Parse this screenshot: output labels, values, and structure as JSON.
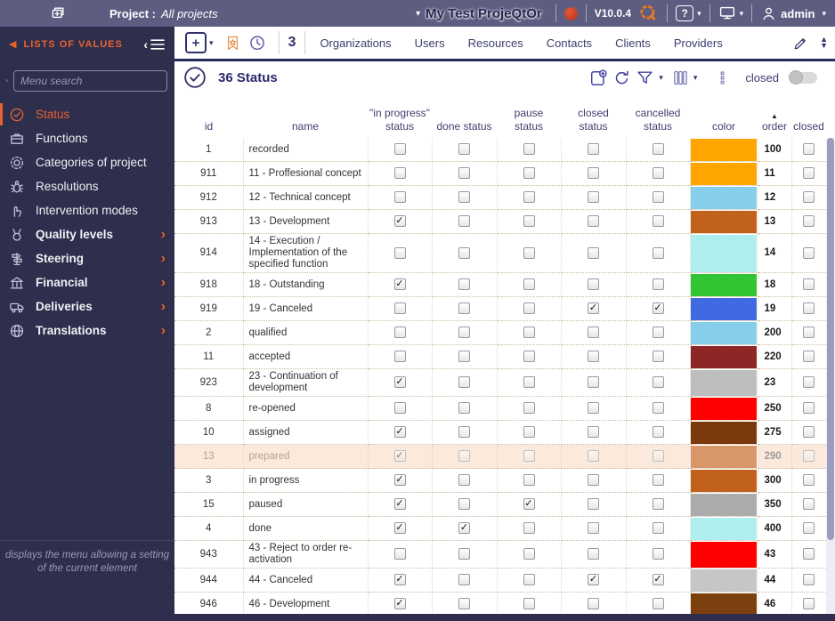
{
  "icons": {
    "caret_down": "▾",
    "chevron_right": "›",
    "sort_asc": "▲",
    "check": "✓",
    "collapse_left": "‹",
    "arrow_left": "◀",
    "up_arrow": "▲",
    "down_arrow": "▼",
    "plus": "+"
  },
  "topbar": {
    "project_label": "Project :",
    "project_value": "All projects",
    "app_title": "My Test ProjeQtOr",
    "version": "V10.0.4",
    "help_label": "?",
    "user_name": "admin"
  },
  "tabbar": {
    "count_badge": "3",
    "tabs": [
      "Organizations",
      "Users",
      "Resources",
      "Contacts",
      "Clients",
      "Providers"
    ]
  },
  "sidebar": {
    "header": "LISTS OF VALUES",
    "search_placeholder": "Menu search",
    "items": [
      {
        "label": "Status",
        "icon": "check-circle-icon",
        "active": true,
        "expandable": false
      },
      {
        "label": "Functions",
        "icon": "briefcase-icon",
        "active": false,
        "expandable": false
      },
      {
        "label": "Categories of project",
        "icon": "gear-icon",
        "active": false,
        "expandable": false
      },
      {
        "label": "Resolutions",
        "icon": "bug-icon",
        "active": false,
        "expandable": false
      },
      {
        "label": "Intervention modes",
        "icon": "hand-icon",
        "active": false,
        "expandable": false
      },
      {
        "label": "Quality levels",
        "icon": "medal-icon",
        "active": false,
        "expandable": true
      },
      {
        "label": "Steering",
        "icon": "signpost-icon",
        "active": false,
        "expandable": true
      },
      {
        "label": "Financial",
        "icon": "bank-icon",
        "active": false,
        "expandable": true
      },
      {
        "label": "Deliveries",
        "icon": "truck-icon",
        "active": false,
        "expandable": true
      },
      {
        "label": "Translations",
        "icon": "globe-icon",
        "active": false,
        "expandable": true
      }
    ],
    "footer_note": "displays the menu allowing a setting of the current element"
  },
  "content": {
    "title": "36 Status",
    "toolbar": {
      "closed_toggle_label": "closed"
    },
    "table": {
      "columns": [
        {
          "key": "id",
          "label": "id",
          "type": "text"
        },
        {
          "key": "name",
          "label": "name",
          "type": "text"
        },
        {
          "key": "in_progress",
          "label": "\"in progress\" status",
          "type": "check"
        },
        {
          "key": "done",
          "label": "done status",
          "type": "check"
        },
        {
          "key": "pause",
          "label": "pause status",
          "type": "check"
        },
        {
          "key": "closed",
          "label": "closed status",
          "type": "check"
        },
        {
          "key": "cancelled",
          "label": "cancelled status",
          "type": "check"
        },
        {
          "key": "color",
          "label": "color",
          "type": "color"
        },
        {
          "key": "order",
          "label": "order",
          "type": "text",
          "sorted": "asc"
        },
        {
          "key": "closed_flag",
          "label": "closed",
          "type": "check"
        }
      ],
      "rows": [
        {
          "id": "1",
          "name": "recorded",
          "in_progress": false,
          "done": false,
          "pause": false,
          "closed": false,
          "cancelled": false,
          "color": "#FFA500",
          "order": "100",
          "closed_flag": false,
          "muted": false
        },
        {
          "id": "911",
          "name": "11 - Proffesional concept",
          "in_progress": false,
          "done": false,
          "pause": false,
          "closed": false,
          "cancelled": false,
          "color": "#FFA500",
          "order": "11",
          "closed_flag": false,
          "muted": false
        },
        {
          "id": "912",
          "name": "12 - Technical concept",
          "in_progress": false,
          "done": false,
          "pause": false,
          "closed": false,
          "cancelled": false,
          "color": "#87CEEB",
          "order": "12",
          "closed_flag": false,
          "muted": false
        },
        {
          "id": "913",
          "name": "13 - Development",
          "in_progress": true,
          "done": false,
          "pause": false,
          "closed": false,
          "cancelled": false,
          "color": "#C2611B",
          "order": "13",
          "closed_flag": false,
          "muted": false
        },
        {
          "id": "914",
          "name": "14 - Execution / Implementation of the specified function",
          "in_progress": false,
          "done": false,
          "pause": false,
          "closed": false,
          "cancelled": false,
          "color": "#AFEEEE",
          "order": "14",
          "closed_flag": false,
          "muted": false
        },
        {
          "id": "918",
          "name": "18 - Outstanding",
          "in_progress": true,
          "done": false,
          "pause": false,
          "closed": false,
          "cancelled": false,
          "color": "#33C433",
          "order": "18",
          "closed_flag": false,
          "muted": false
        },
        {
          "id": "919",
          "name": "19 - Canceled",
          "in_progress": false,
          "done": false,
          "pause": false,
          "closed": true,
          "cancelled": true,
          "color": "#4169E1",
          "order": "19",
          "closed_flag": false,
          "muted": false
        },
        {
          "id": "2",
          "name": "qualified",
          "in_progress": false,
          "done": false,
          "pause": false,
          "closed": false,
          "cancelled": false,
          "color": "#87CEEB",
          "order": "200",
          "closed_flag": false,
          "muted": false
        },
        {
          "id": "11",
          "name": "accepted",
          "in_progress": false,
          "done": false,
          "pause": false,
          "closed": false,
          "cancelled": false,
          "color": "#8E2626",
          "order": "220",
          "closed_flag": false,
          "muted": false
        },
        {
          "id": "923",
          "name": "23 - Continuation of development",
          "in_progress": true,
          "done": false,
          "pause": false,
          "closed": false,
          "cancelled": false,
          "color": "#BEBEBE",
          "order": "23",
          "closed_flag": false,
          "muted": false
        },
        {
          "id": "8",
          "name": "re-opened",
          "in_progress": false,
          "done": false,
          "pause": false,
          "closed": false,
          "cancelled": false,
          "color": "#FF0000",
          "order": "250",
          "closed_flag": false,
          "muted": false
        },
        {
          "id": "10",
          "name": "assigned",
          "in_progress": true,
          "done": false,
          "pause": false,
          "closed": false,
          "cancelled": false,
          "color": "#7A3A0D",
          "order": "275",
          "closed_flag": false,
          "muted": false
        },
        {
          "id": "13",
          "name": "prepared",
          "in_progress": true,
          "done": false,
          "pause": false,
          "closed": false,
          "cancelled": false,
          "color": "#D8976B",
          "order": "290",
          "closed_flag": false,
          "muted": true
        },
        {
          "id": "3",
          "name": "in progress",
          "in_progress": true,
          "done": false,
          "pause": false,
          "closed": false,
          "cancelled": false,
          "color": "#C2611B",
          "order": "300",
          "closed_flag": false,
          "muted": false
        },
        {
          "id": "15",
          "name": "paused",
          "in_progress": true,
          "done": false,
          "pause": true,
          "closed": false,
          "cancelled": false,
          "color": "#ABABAB",
          "order": "350",
          "closed_flag": false,
          "muted": false
        },
        {
          "id": "4",
          "name": "done",
          "in_progress": true,
          "done": true,
          "pause": false,
          "closed": false,
          "cancelled": false,
          "color": "#AFEEEE",
          "order": "400",
          "closed_flag": false,
          "muted": false
        },
        {
          "id": "943",
          "name": "43 - Reject to order re-activation",
          "in_progress": false,
          "done": false,
          "pause": false,
          "closed": false,
          "cancelled": false,
          "color": "#FF0000",
          "order": "43",
          "closed_flag": false,
          "muted": false
        },
        {
          "id": "944",
          "name": "44 - Canceled",
          "in_progress": true,
          "done": false,
          "pause": false,
          "closed": true,
          "cancelled": true,
          "color": "#C6C6C6",
          "order": "44",
          "closed_flag": false,
          "muted": false
        },
        {
          "id": "946",
          "name": "46 - Development",
          "in_progress": true,
          "done": false,
          "pause": false,
          "closed": false,
          "cancelled": false,
          "color": "#7C400E",
          "order": "46",
          "closed_flag": false,
          "muted": false
        }
      ]
    }
  },
  "colors": {
    "topbar_bg": "#5D5D82",
    "sidebar_bg": "#2E2E4D",
    "accent_orange": "#E8622D",
    "navy_text": "#2A2A6E",
    "row_highlight": "#FBE9DB"
  }
}
